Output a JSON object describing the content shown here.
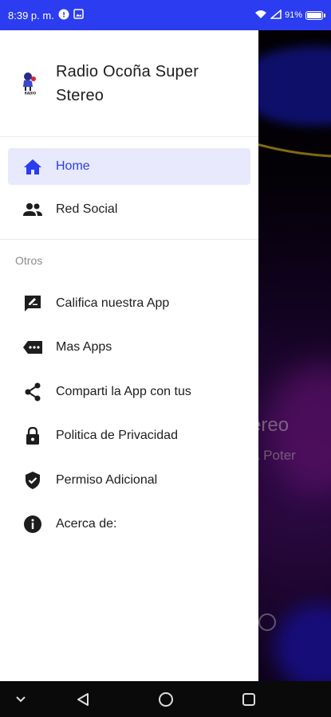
{
  "status_bar": {
    "time": "8:39 p. m.",
    "battery": "91%",
    "battery_level": 0.91
  },
  "background_app": {
    "title_fragment": "ereo",
    "subtitle_fragment": "a Poter"
  },
  "drawer": {
    "app_title": "Radio Ocoña Super Stereo",
    "logo_text": "RADIO OCOÑA",
    "primary_items": [
      {
        "label": "Home",
        "icon": "home-icon",
        "active": true
      },
      {
        "label": "Red Social",
        "icon": "people-icon",
        "active": false
      }
    ],
    "section_label": "Otros",
    "secondary_items": [
      {
        "label": "Califica nuestra App",
        "icon": "rate-review-icon"
      },
      {
        "label": "Mas Apps",
        "icon": "more-tag-icon"
      },
      {
        "label": "Comparti la App con tus",
        "icon": "share-icon"
      },
      {
        "label": "Politica de Privacidad",
        "icon": "lock-icon"
      },
      {
        "label": "Permiso Adicional",
        "icon": "shield-check-icon"
      },
      {
        "label": "Acerca de:",
        "icon": "info-icon"
      }
    ]
  },
  "colors": {
    "accent": "#2c3cf0",
    "active_bg": "#e8e9fc",
    "status_bar": "#2c3cf0"
  }
}
